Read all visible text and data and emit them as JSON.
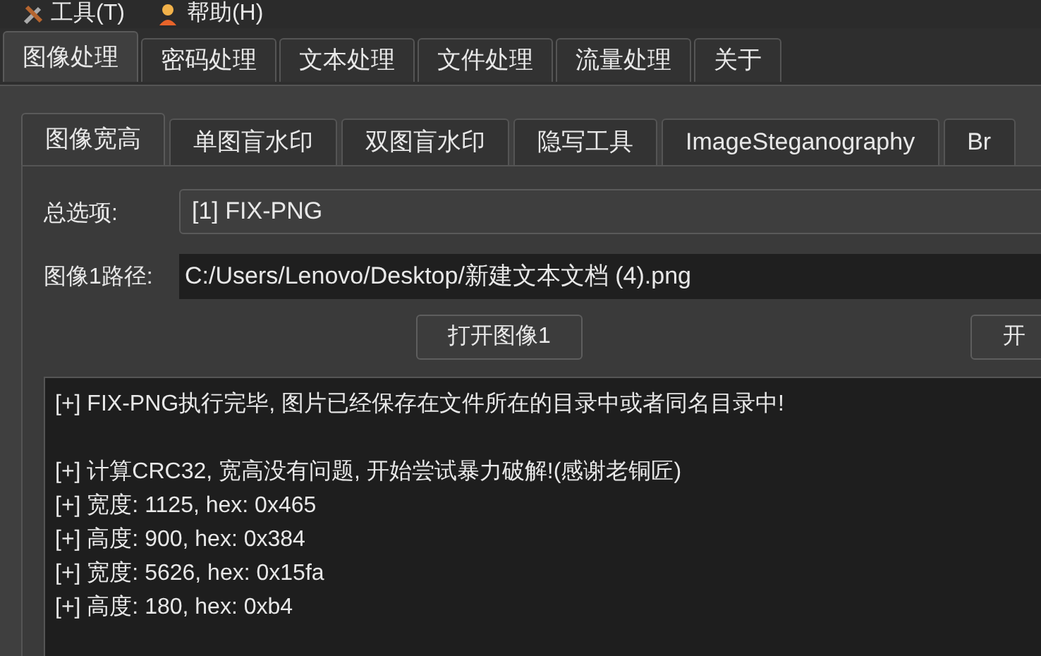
{
  "menu": [
    {
      "kind": "tools",
      "label": "工具(T)"
    },
    {
      "kind": "help",
      "label": "帮助(H)"
    }
  ],
  "main_tabs": [
    {
      "label": "图像处理",
      "selected": true
    },
    {
      "label": "密码处理",
      "selected": false
    },
    {
      "label": "文本处理",
      "selected": false
    },
    {
      "label": "文件处理",
      "selected": false
    },
    {
      "label": "流量处理",
      "selected": false
    },
    {
      "label": "关于",
      "selected": false
    }
  ],
  "sub_tabs": [
    {
      "label": "图像宽高",
      "selected": true
    },
    {
      "label": "单图盲水印",
      "selected": false
    },
    {
      "label": "双图盲水印",
      "selected": false
    },
    {
      "label": "隐写工具",
      "selected": false
    },
    {
      "label": "ImageSteganography",
      "selected": false
    },
    {
      "label": "Br",
      "selected": false
    }
  ],
  "option": {
    "label": "总选项:",
    "value": "[1] FIX-PNG"
  },
  "path": {
    "label": "图像1路径:",
    "value": "C:/Users/Lenovo/Desktop/新建文本文档 (4).png"
  },
  "buttons": [
    "打开图像1",
    "开"
  ],
  "log": [
    {
      "lines": [
        "[+] FIX-PNG执行完毕, 图片已经保存在文件所在的目录中或者同名目录中!"
      ]
    },
    {
      "lines": [
        "[+] 计算CRC32, 宽高没有问题, 开始尝试暴力破解!(感谢老铜匠)",
        "[+] 宽度: 1125, hex: 0x465",
        "[+] 高度: 900, hex: 0x384",
        "[+] 宽度: 5626, hex: 0x15fa",
        "[+] 高度: 180, hex: 0xb4"
      ]
    }
  ]
}
